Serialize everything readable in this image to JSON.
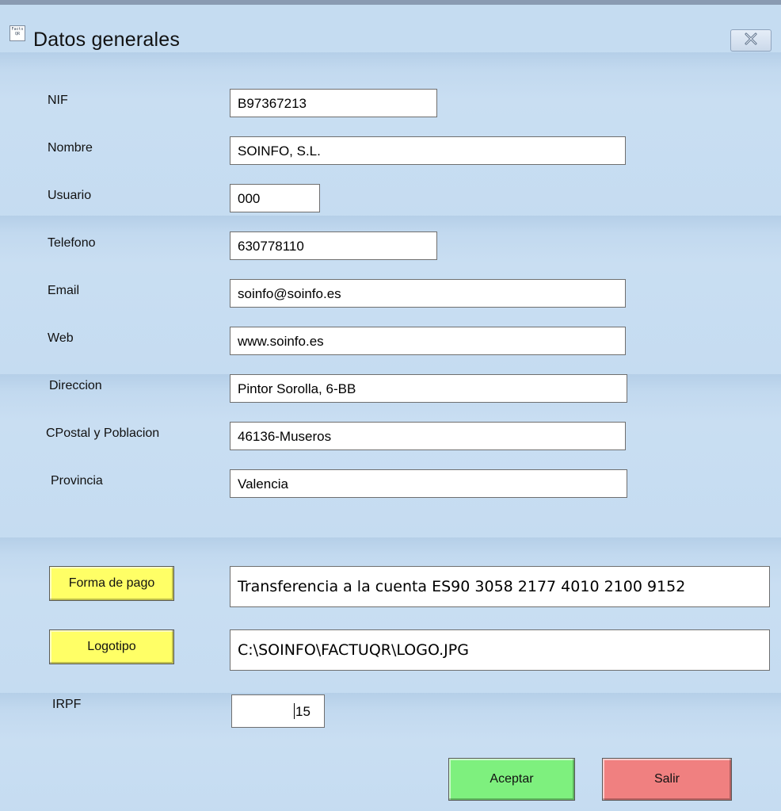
{
  "window": {
    "title": "Datos generales",
    "icon_text": "Facts QR"
  },
  "fields": {
    "nif": {
      "label": "NIF",
      "value": "B97367213"
    },
    "nombre": {
      "label": "Nombre",
      "value": "SOINFO, S.L."
    },
    "usuario": {
      "label": "Usuario",
      "value": "000"
    },
    "telefono": {
      "label": "Telefono",
      "value": "630778110"
    },
    "email": {
      "label": "Email",
      "value": "soinfo@soinfo.es"
    },
    "web": {
      "label": "Web",
      "value": "www.soinfo.es"
    },
    "direccion": {
      "label": "Direccion",
      "value": "Pintor Sorolla, 6-BB"
    },
    "cpostal": {
      "label": "CPostal y Poblacion",
      "value": "46136-Museros"
    },
    "provincia": {
      "label": "Provincia",
      "value": "Valencia"
    },
    "forma_pago": {
      "value": "Transferencia a la cuenta ES90 3058 2177 4010 2100 9152"
    },
    "logotipo": {
      "value": "C:\\SOINFO\\FACTUQR\\LOGO.JPG"
    },
    "irpf": {
      "label": "IRPF",
      "value": "15"
    }
  },
  "buttons": {
    "forma_pago": "Forma de pago",
    "logotipo": "Logotipo",
    "aceptar": "Aceptar",
    "salir": "Salir"
  },
  "colors": {
    "background": "#c5dcf1",
    "yellow_button": "#ffff66",
    "accept_button": "#7ef07e",
    "exit_button": "#f08080"
  },
  "icons": {
    "close": "close-icon",
    "app": "app-icon"
  }
}
